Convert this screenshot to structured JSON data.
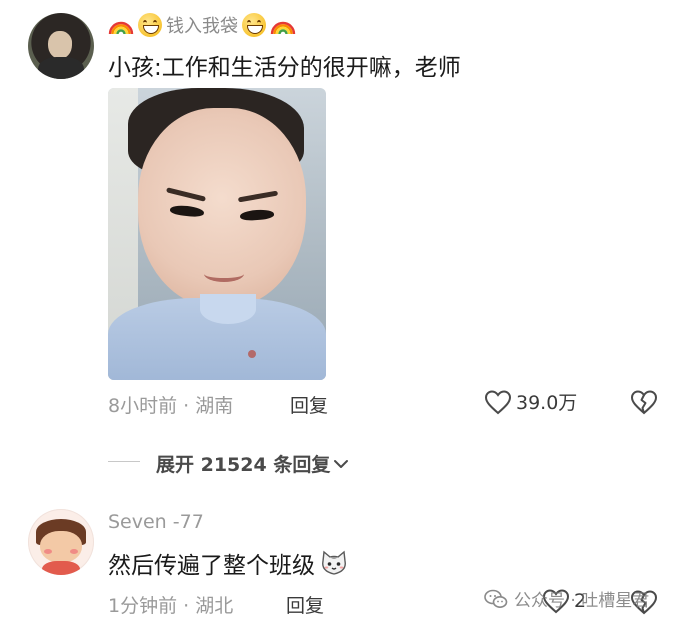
{
  "comments": [
    {
      "username": "钱入我袋",
      "text": "小孩:工作和生活分的很开嘛，老师",
      "time_location": "8小时前 · 湖南",
      "reply_label": "回复",
      "likes": "39.0万"
    },
    {
      "username": "Seven -77",
      "text": "然后传遍了整个班级",
      "time_location": "1分钟前 · 湖北",
      "reply_label": "回复",
      "likes": "2"
    }
  ],
  "expand_replies_label": "展开 21524 条回复",
  "watermark_text": "公众号 · 吐槽星君",
  "icons": {
    "username_decor": [
      "rainbow-icon",
      "grin-emoji-icon"
    ],
    "like": "heart-outline-icon",
    "dislike": "broken-heart-icon",
    "expand": "chevron-down-icon",
    "cat_emoji": "cat-emoji-icon",
    "watermark": "wechat-icon"
  }
}
